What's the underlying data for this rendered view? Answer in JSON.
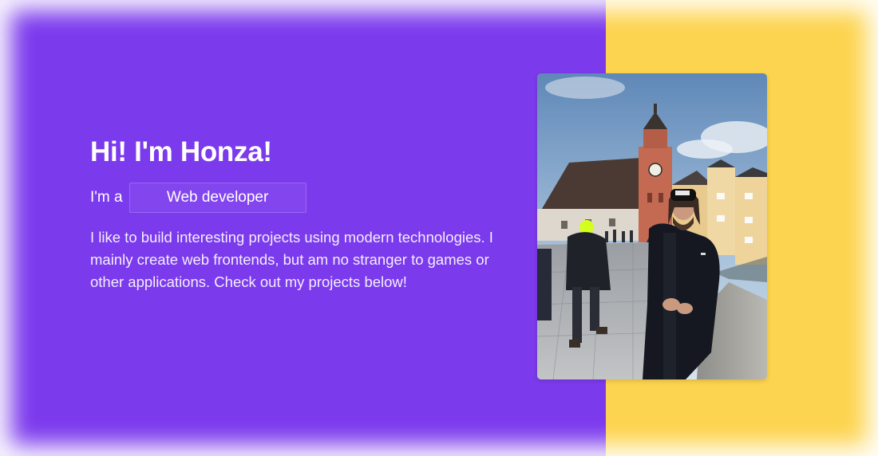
{
  "hero": {
    "title": "Hi! I'm Honza!",
    "role_prefix": "I'm a",
    "role": "Web developer",
    "intro": "I like to build interesting projects using modern technologies. I mainly create web frontends, but am no stranger to games or other applications. Check out my projects below!"
  },
  "colors": {
    "primary": "#7c3aed",
    "accent": "#fdd44f",
    "text": "#ffffff"
  }
}
